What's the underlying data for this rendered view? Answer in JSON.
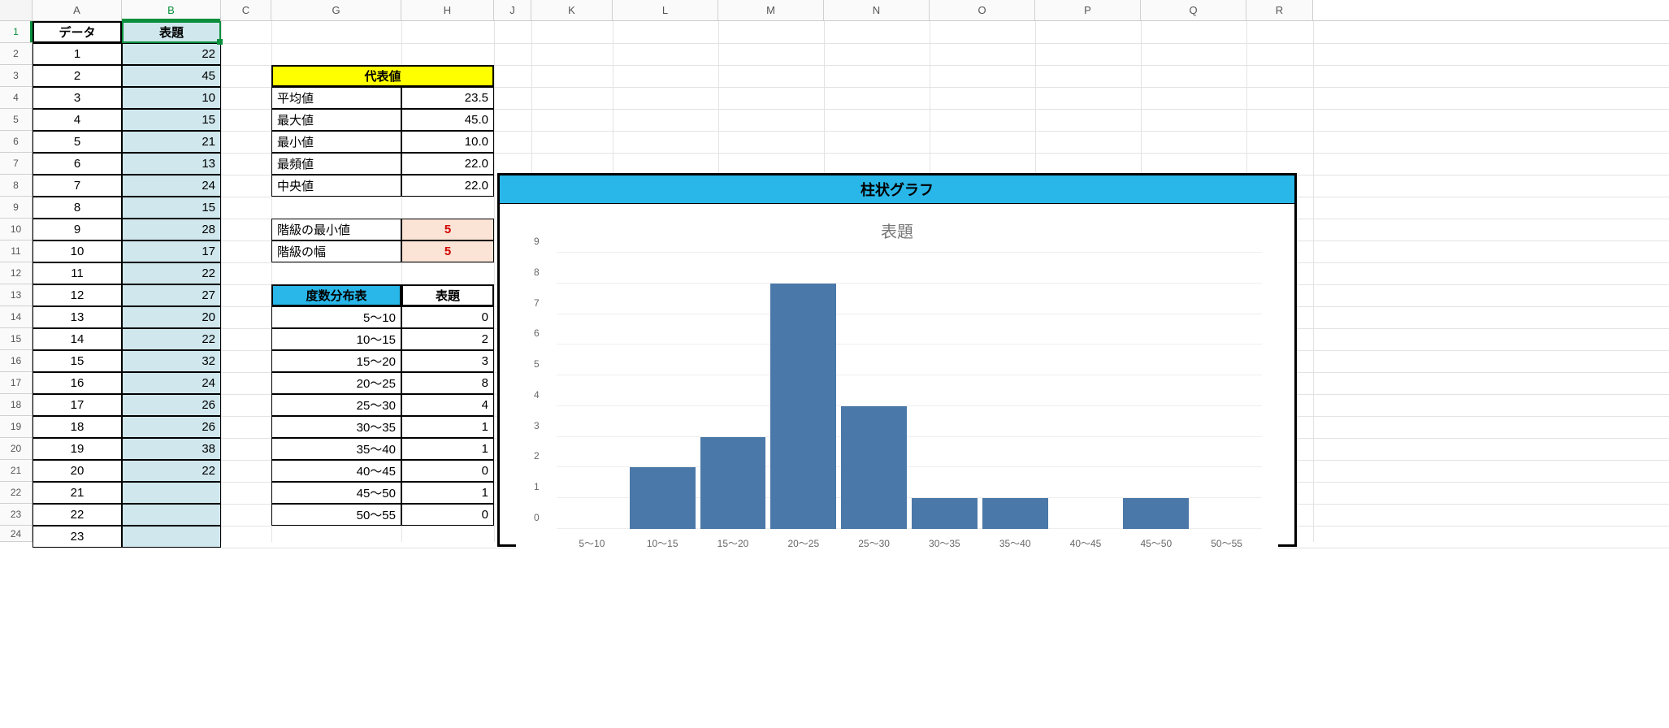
{
  "columns": [
    "A",
    "B",
    "C",
    "G",
    "H",
    "J",
    "K",
    "L",
    "M",
    "N",
    "O",
    "P",
    "Q",
    "R"
  ],
  "col_widths": {
    "A": 110,
    "B": 122,
    "C": 62,
    "G": 160,
    "H": 114,
    "J": 46,
    "K": 100,
    "L": 130,
    "M": 130,
    "N": 130,
    "O": 130,
    "P": 130,
    "Q": 130,
    "R": 82
  },
  "row_count": 24,
  "active_col": "B",
  "active_row": 1,
  "headers": {
    "A": "データ",
    "B": "表題"
  },
  "data_col_A": [
    "1",
    "2",
    "3",
    "4",
    "5",
    "6",
    "7",
    "8",
    "9",
    "10",
    "11",
    "12",
    "13",
    "14",
    "15",
    "16",
    "17",
    "18",
    "19",
    "20",
    "21",
    "22",
    "23"
  ],
  "data_col_B": [
    "22",
    "45",
    "10",
    "15",
    "21",
    "13",
    "24",
    "15",
    "28",
    "17",
    "22",
    "27",
    "20",
    "22",
    "32",
    "24",
    "26",
    "26",
    "38",
    "22",
    "",
    "",
    ""
  ],
  "stats_title": "代表値",
  "stats": [
    {
      "label": "平均値",
      "value": "23.5"
    },
    {
      "label": "最大値",
      "value": "45.0"
    },
    {
      "label": "最小値",
      "value": "10.0"
    },
    {
      "label": "最頻値",
      "value": "22.0"
    },
    {
      "label": "中央値",
      "value": "22.0"
    }
  ],
  "class_params": [
    {
      "label": "階級の最小値",
      "value": "5"
    },
    {
      "label": "階級の幅",
      "value": "5"
    }
  ],
  "freq_title_left": "度数分布表",
  "freq_title_right": "表題",
  "freq_table": [
    {
      "range": "5〜10",
      "count": "0"
    },
    {
      "range": "10〜15",
      "count": "2"
    },
    {
      "range": "15〜20",
      "count": "3"
    },
    {
      "range": "20〜25",
      "count": "8"
    },
    {
      "range": "25〜30",
      "count": "4"
    },
    {
      "range": "30〜35",
      "count": "1"
    },
    {
      "range": "35〜40",
      "count": "1"
    },
    {
      "range": "40〜45",
      "count": "0"
    },
    {
      "range": "45〜50",
      "count": "1"
    },
    {
      "range": "50〜55",
      "count": "0"
    }
  ],
  "chart_box_title": "柱状グラフ",
  "chart_inner_title": "表題",
  "chart_data": {
    "type": "bar",
    "title": "表題",
    "categories": [
      "5〜10",
      "10〜15",
      "15〜20",
      "20〜25",
      "25〜30",
      "30〜35",
      "35〜40",
      "40〜45",
      "45〜50",
      "50〜55"
    ],
    "values": [
      0,
      2,
      3,
      8,
      4,
      1,
      1,
      0,
      1,
      0
    ],
    "xlabel": "",
    "ylabel": "",
    "ylim": [
      0,
      9
    ],
    "y_ticks": [
      0,
      1,
      2,
      3,
      4,
      5,
      6,
      7,
      8,
      9
    ]
  }
}
